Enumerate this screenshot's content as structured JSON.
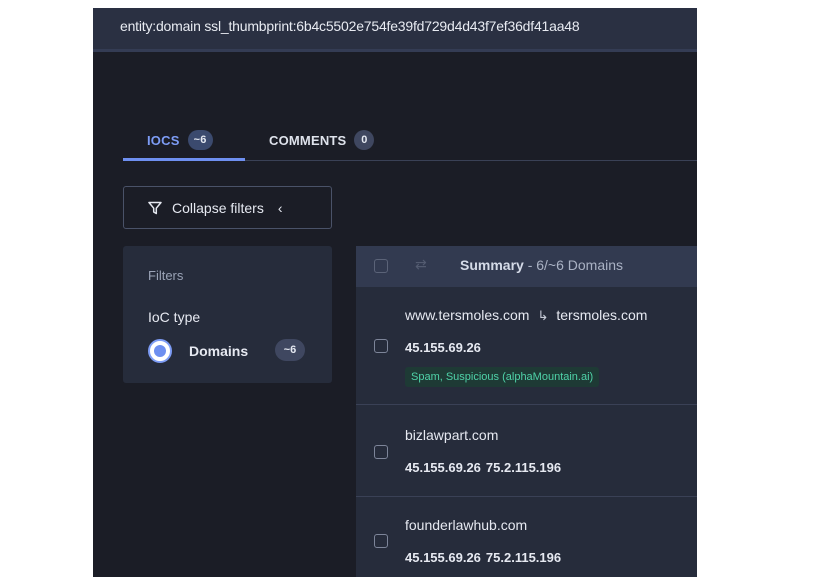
{
  "search": {
    "query": "entity:domain ssl_thumbprint:6b4c5502e754fe39fd729d4d43f7ef36df41aa48"
  },
  "tabs": [
    {
      "label": "IOCS",
      "count": "~6",
      "active": true
    },
    {
      "label": "COMMENTS",
      "count": "0",
      "active": false
    }
  ],
  "filters_toggle": {
    "label": "Collapse filters"
  },
  "filters": {
    "title": "Filters",
    "group_label": "IoC type",
    "option": {
      "label": "Domains",
      "count": "~6",
      "selected": true
    }
  },
  "results": {
    "summary_label": "Summary",
    "summary_detail": " - 6/~6 Domains",
    "rows": [
      {
        "domain": "www.tersmoles.com",
        "redirect_target": "tersmoles.com",
        "ips": [
          "45.155.69.26"
        ],
        "tag": "Spam, Suspicious (alphaMountain.ai)"
      },
      {
        "domain": "bizlawpart.com",
        "ips": [
          "45.155.69.26",
          "75.2.115.196"
        ]
      },
      {
        "domain": "founderlawhub.com",
        "ips": [
          "45.155.69.26",
          "75.2.115.196"
        ]
      }
    ]
  },
  "colors": {
    "accent": "#6e8ff0",
    "background": "#1b1d26",
    "panel": "#262c3b",
    "tag_text": "#4fd2a8"
  },
  "icons": {
    "search": "search-icon",
    "filter": "funnel-icon",
    "collapse": "chevron-left-icon",
    "redirect": "redirect-arrow-icon",
    "swap": "swap-icon"
  }
}
